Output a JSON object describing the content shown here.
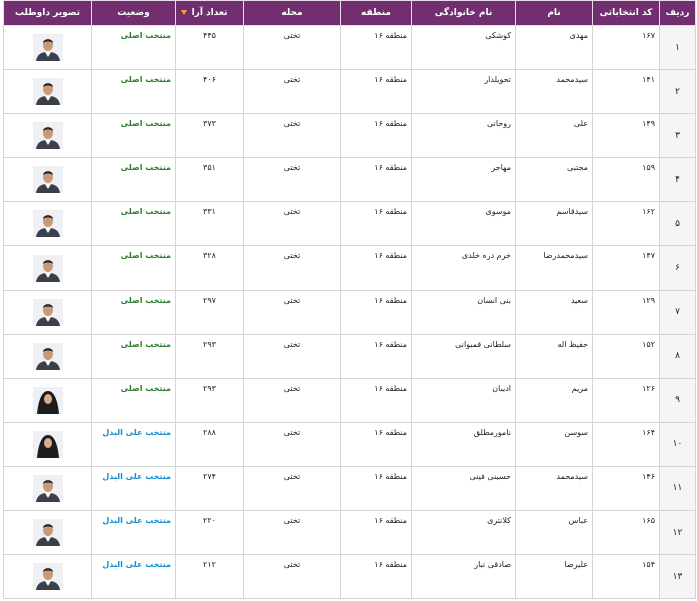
{
  "table": {
    "headers": {
      "idx": "ردیف",
      "code": "کد انتخاباتی",
      "name": "نام",
      "family": "نام خانوادگی",
      "region": "منطقه",
      "place": "محله",
      "votes": "تعداد آرا",
      "status": "وضعیت",
      "photo": "تصویر داوطلب"
    },
    "rows": [
      {
        "idx": "۱",
        "code": "۱۶۷",
        "name": "مهدی",
        "family": "کوشکی",
        "region": "منطقه ۱۶",
        "place": "تختی",
        "votes": "۴۴۵",
        "status": "منتخب اصلی",
        "status_type": "main",
        "photo": "male-portrait-icon"
      },
      {
        "idx": "۲",
        "code": "۱۴۱",
        "name": "سیدمحمد",
        "family": "تحویلدار",
        "region": "منطقه ۱۶",
        "place": "تختی",
        "votes": "۴۰۶",
        "status": "منتخب اصلی",
        "status_type": "main",
        "photo": "male-portrait-icon"
      },
      {
        "idx": "۳",
        "code": "۱۴۹",
        "name": "علی",
        "family": "روحانی",
        "region": "منطقه ۱۶",
        "place": "تختی",
        "votes": "۳۷۳",
        "status": "منتخب اصلی",
        "status_type": "main",
        "photo": "male-portrait-icon"
      },
      {
        "idx": "۴",
        "code": "۱۵۹",
        "name": "مجتبی",
        "family": "مهاجر",
        "region": "منطقه ۱۶",
        "place": "تختی",
        "votes": "۳۵۱",
        "status": "منتخب اصلی",
        "status_type": "main",
        "photo": "male-portrait-icon"
      },
      {
        "idx": "۵",
        "code": "۱۶۲",
        "name": "سیدقاسم",
        "family": "موسوی",
        "region": "منطقه ۱۶",
        "place": "تختی",
        "votes": "۳۳۱",
        "status": "منتخب اصلی",
        "status_type": "main",
        "photo": "male-portrait-icon"
      },
      {
        "idx": "۶",
        "code": "۱۴۷",
        "name": "سیدمحمدرضا",
        "family": "خرم دره خلدی",
        "region": "منطقه ۱۶",
        "place": "تختی",
        "votes": "۳۲۸",
        "status": "منتخب اصلی",
        "status_type": "main",
        "photo": "male-portrait-icon"
      },
      {
        "idx": "۷",
        "code": "۱۲۹",
        "name": "سعید",
        "family": "بنی انسان",
        "region": "منطقه ۱۶",
        "place": "تختی",
        "votes": "۲۹۷",
        "status": "منتخب اصلی",
        "status_type": "main",
        "photo": "male-portrait-icon"
      },
      {
        "idx": "۸",
        "code": "۱۵۲",
        "name": "حفیظ اله",
        "family": "سلطانی قمبوانی",
        "region": "منطقه ۱۶",
        "place": "تختی",
        "votes": "۲۹۳",
        "status": "منتخب اصلی",
        "status_type": "main",
        "photo": "male-portrait-icon"
      },
      {
        "idx": "۹",
        "code": "۱۲۶",
        "name": "مریم",
        "family": "ادیبان",
        "region": "منطقه ۱۶",
        "place": "تختی",
        "votes": "۲۹۳",
        "status": "منتخب اصلی",
        "status_type": "main",
        "photo": "female-portrait-icon"
      },
      {
        "idx": "۱۰",
        "code": "۱۶۴",
        "name": "سوسن",
        "family": "نامورمطلق",
        "region": "منطقه ۱۶",
        "place": "تختی",
        "votes": "۲۸۸",
        "status": "منتخب علی البدل",
        "status_type": "alt",
        "photo": "female-portrait-icon"
      },
      {
        "idx": "۱۱",
        "code": "۱۴۶",
        "name": "سیدمحمد",
        "family": "حسینی فینی",
        "region": "منطقه ۱۶",
        "place": "تختی",
        "votes": "۲۷۴",
        "status": "منتخب علی البدل",
        "status_type": "alt",
        "photo": "male-portrait-icon"
      },
      {
        "idx": "۱۲",
        "code": "۱۶۵",
        "name": "عباس",
        "family": "کلانتری",
        "region": "منطقه ۱۶",
        "place": "تختی",
        "votes": "۲۲۰",
        "status": "منتخب علی البدل",
        "status_type": "alt",
        "photo": "male-portrait-icon"
      },
      {
        "idx": "۱۳",
        "code": "۱۵۴",
        "name": "علیرضا",
        "family": "صادقی تبار",
        "region": "منطقه ۱۶",
        "place": "تختی",
        "votes": "۲۱۲",
        "status": "منتخب علی البدل",
        "status_type": "alt",
        "photo": "male-portrait-icon"
      }
    ]
  },
  "colors": {
    "header_bg": "#722f6f",
    "status_main": "#2e7d32",
    "status_alt": "#1a8fd0",
    "sort_arrow": "#f5a623"
  }
}
